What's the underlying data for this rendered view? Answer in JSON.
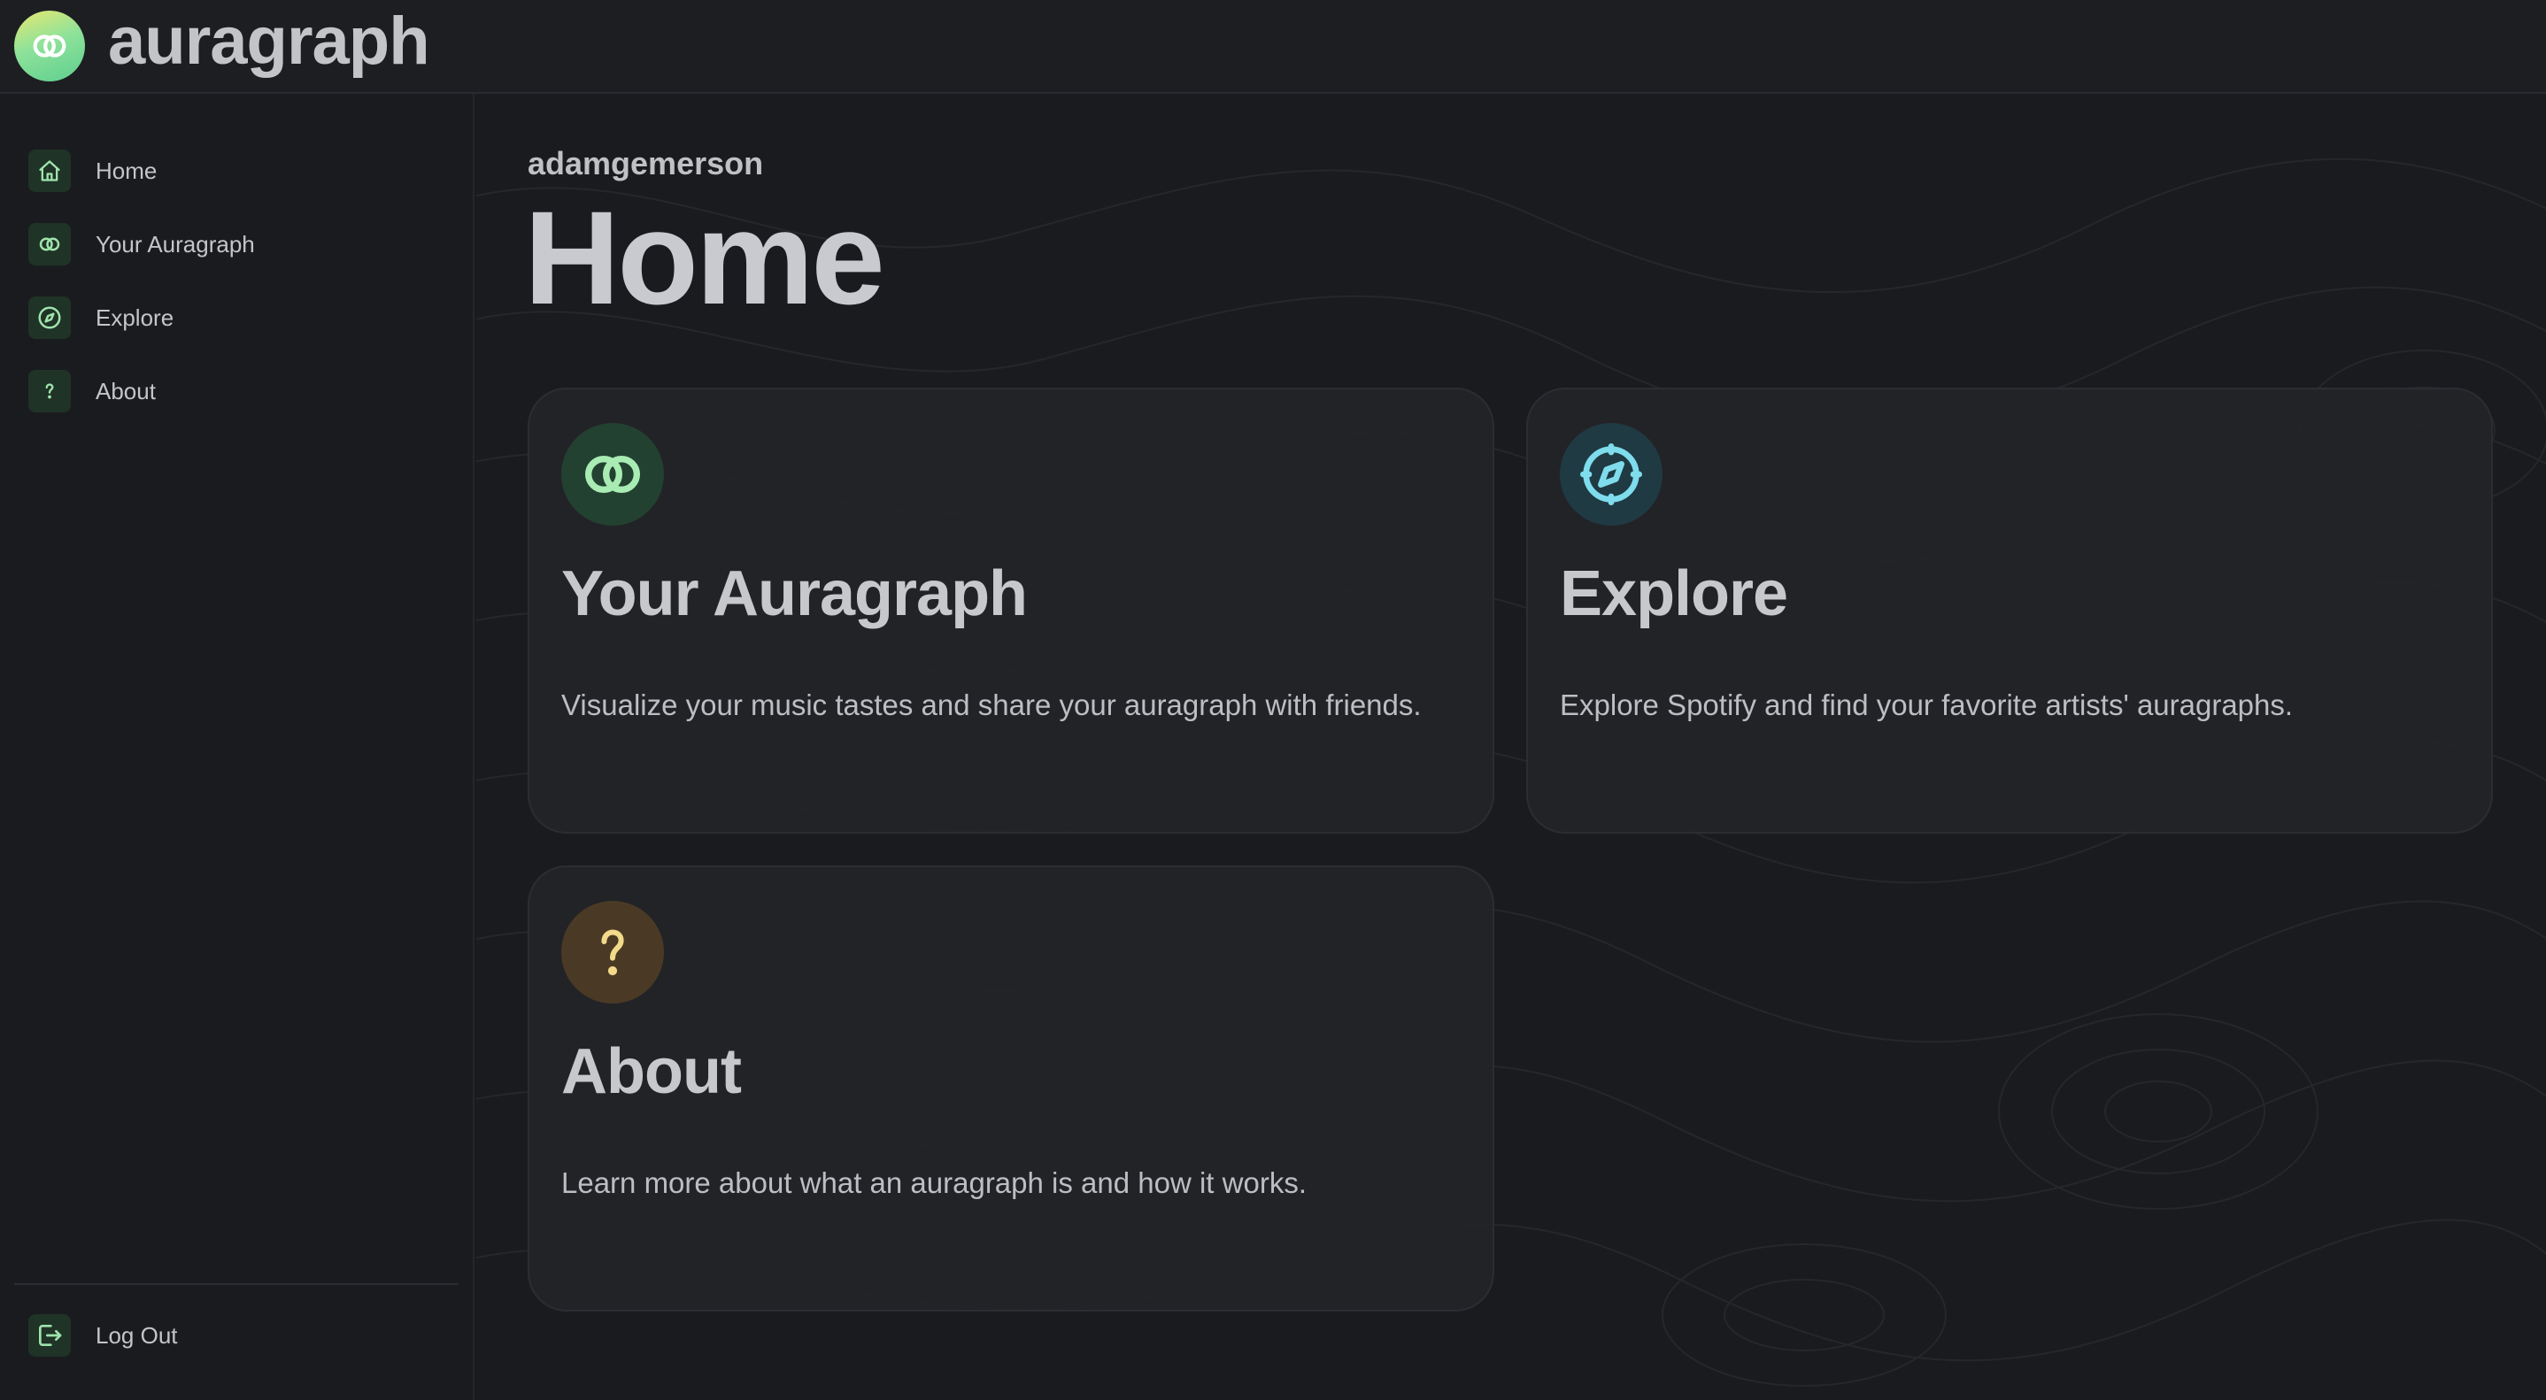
{
  "app": {
    "brand": "auragraph",
    "brand_gradient": [
      "#e8e870",
      "#5ecf8f"
    ]
  },
  "sidebar": {
    "items": [
      {
        "label": "Home",
        "icon": "home-icon"
      },
      {
        "label": "Your Auragraph",
        "icon": "rings-icon"
      },
      {
        "label": "Explore",
        "icon": "compass-icon"
      },
      {
        "label": "About",
        "icon": "question-icon"
      }
    ],
    "logout": {
      "label": "Log Out",
      "icon": "logout-icon"
    }
  },
  "main": {
    "username": "adamgemerson",
    "title": "Home",
    "cards": [
      {
        "title": "Your Auragraph",
        "description": "Visualize your music tastes and share your auragraph with friends.",
        "icon": "rings-icon",
        "accent": "#a8ecb4",
        "icon_bg": "#234131"
      },
      {
        "title": "Explore",
        "description": "Explore Spotify and find your favorite artists' auragraphs.",
        "icon": "compass-icon",
        "accent": "#7fdcec",
        "icon_bg": "#1f3a42"
      },
      {
        "title": "About",
        "description": "Learn more about what an auragraph is and how it works.",
        "icon": "question-icon",
        "accent": "#f3d98a",
        "icon_bg": "#4a3a25"
      }
    ]
  },
  "colors": {
    "background": "#1a1b1e",
    "sidebar_icon_bg": "#1f3326",
    "sidebar_icon_fg": "#9fe3ad"
  }
}
